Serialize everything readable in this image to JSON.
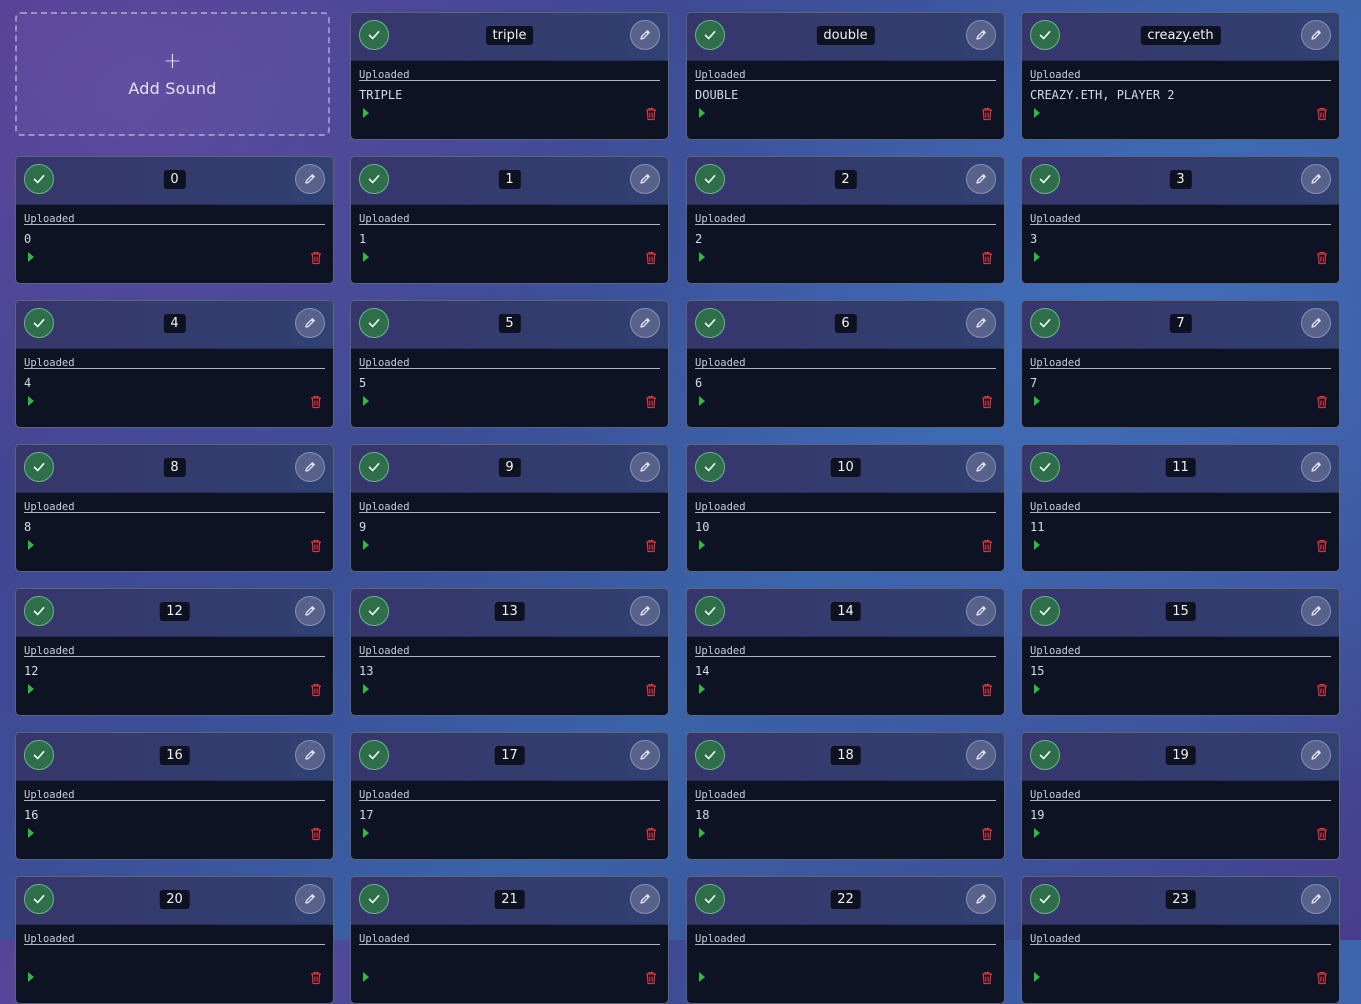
{
  "add_sound": {
    "plus": "+",
    "label": "Add Sound"
  },
  "sounds": [
    {
      "name": "triple",
      "status": "Uploaded",
      "text": "TRIPLE"
    },
    {
      "name": "double",
      "status": "Uploaded",
      "text": "DOUBLE"
    },
    {
      "name": "creazy.eth",
      "status": "Uploaded",
      "text": "CREAZY.ETH, PLAYER 2"
    },
    {
      "name": "0",
      "status": "Uploaded",
      "text": "0"
    },
    {
      "name": "1",
      "status": "Uploaded",
      "text": "1"
    },
    {
      "name": "2",
      "status": "Uploaded",
      "text": "2"
    },
    {
      "name": "3",
      "status": "Uploaded",
      "text": "3"
    },
    {
      "name": "4",
      "status": "Uploaded",
      "text": "4"
    },
    {
      "name": "5",
      "status": "Uploaded",
      "text": "5"
    },
    {
      "name": "6",
      "status": "Uploaded",
      "text": "6"
    },
    {
      "name": "7",
      "status": "Uploaded",
      "text": "7"
    },
    {
      "name": "8",
      "status": "Uploaded",
      "text": "8"
    },
    {
      "name": "9",
      "status": "Uploaded",
      "text": "9"
    },
    {
      "name": "10",
      "status": "Uploaded",
      "text": "10"
    },
    {
      "name": "11",
      "status": "Uploaded",
      "text": "11"
    },
    {
      "name": "12",
      "status": "Uploaded",
      "text": "12"
    },
    {
      "name": "13",
      "status": "Uploaded",
      "text": "13"
    },
    {
      "name": "14",
      "status": "Uploaded",
      "text": "14"
    },
    {
      "name": "15",
      "status": "Uploaded",
      "text": "15"
    },
    {
      "name": "16",
      "status": "Uploaded",
      "text": "16"
    },
    {
      "name": "17",
      "status": "Uploaded",
      "text": "17"
    },
    {
      "name": "18",
      "status": "Uploaded",
      "text": "18"
    },
    {
      "name": "19",
      "status": "Uploaded",
      "text": "19"
    },
    {
      "name": "20",
      "status": "Uploaded",
      "text": ""
    },
    {
      "name": "21",
      "status": "Uploaded",
      "text": ""
    },
    {
      "name": "22",
      "status": "Uploaded",
      "text": ""
    },
    {
      "name": "23",
      "status": "Uploaded",
      "text": ""
    }
  ],
  "icons": {
    "confirm": "check-icon",
    "edit": "pencil-icon",
    "play": "play-icon",
    "delete": "trash-icon"
  },
  "colors": {
    "play": "#2fb84a",
    "delete": "#d9363e",
    "confirm_bg": "#2e6e4a"
  }
}
